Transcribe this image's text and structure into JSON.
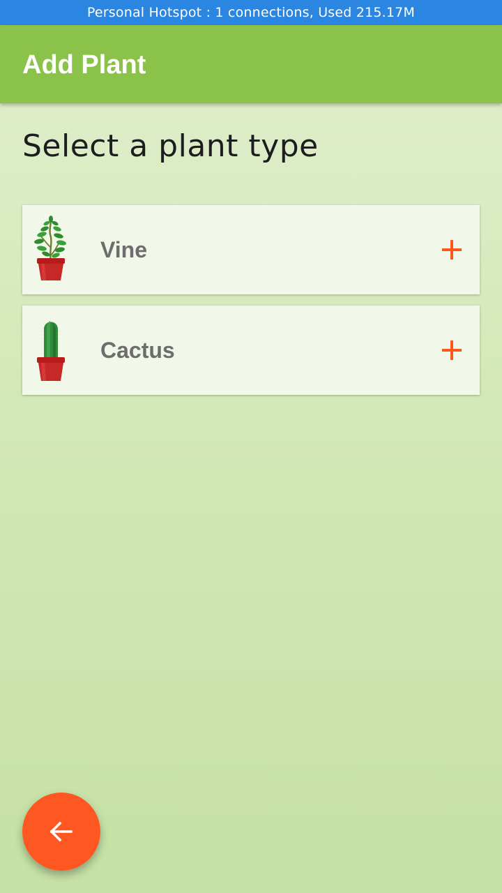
{
  "status_bar": {
    "text": "Personal Hotspot : 1 connections, Used 215.17M"
  },
  "app_bar": {
    "title": "Add Plant",
    "color": "#8bc34a"
  },
  "main": {
    "heading": "Select a plant type",
    "plant_types": [
      {
        "label": "Vine",
        "icon": "vine-plant-icon",
        "action_icon": "plus-icon"
      },
      {
        "label": "Cactus",
        "icon": "cactus-plant-icon",
        "action_icon": "plus-icon"
      }
    ]
  },
  "fab": {
    "icon": "arrow-back-icon",
    "color": "#ff5722"
  },
  "colors": {
    "accent": "#ff5722",
    "status_bar": "#2a86e0",
    "card_background": "#f1f8e9"
  }
}
